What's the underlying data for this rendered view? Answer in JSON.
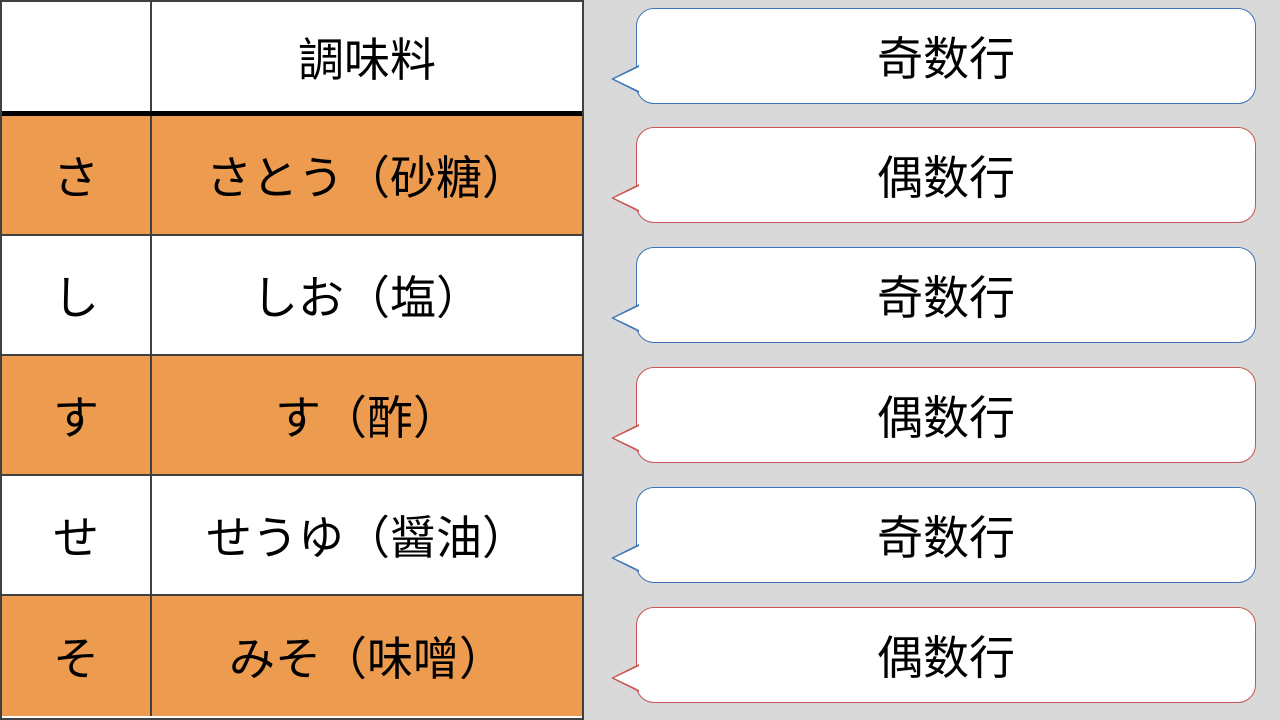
{
  "colors": {
    "background": "#d9d9d9",
    "row_highlight": "#ed9b4f",
    "odd_border": "#3b74b9",
    "even_border": "#c75450"
  },
  "table": {
    "header": {
      "col1": "",
      "col2": "調味料"
    },
    "rows": [
      {
        "col1": "さ",
        "col2": "さとう（砂糖）",
        "parity": "even"
      },
      {
        "col1": "し",
        "col2": "しお（塩）",
        "parity": "odd"
      },
      {
        "col1": "す",
        "col2": "す（酢）",
        "parity": "even"
      },
      {
        "col1": "せ",
        "col2": "せうゆ（醤油）",
        "parity": "odd"
      },
      {
        "col1": "そ",
        "col2": "みそ（味噌）",
        "parity": "even"
      }
    ]
  },
  "callouts": [
    {
      "label": "奇数行",
      "parity": "odd"
    },
    {
      "label": "偶数行",
      "parity": "even"
    },
    {
      "label": "奇数行",
      "parity": "odd"
    },
    {
      "label": "偶数行",
      "parity": "even"
    },
    {
      "label": "奇数行",
      "parity": "odd"
    },
    {
      "label": "偶数行",
      "parity": "even"
    }
  ]
}
